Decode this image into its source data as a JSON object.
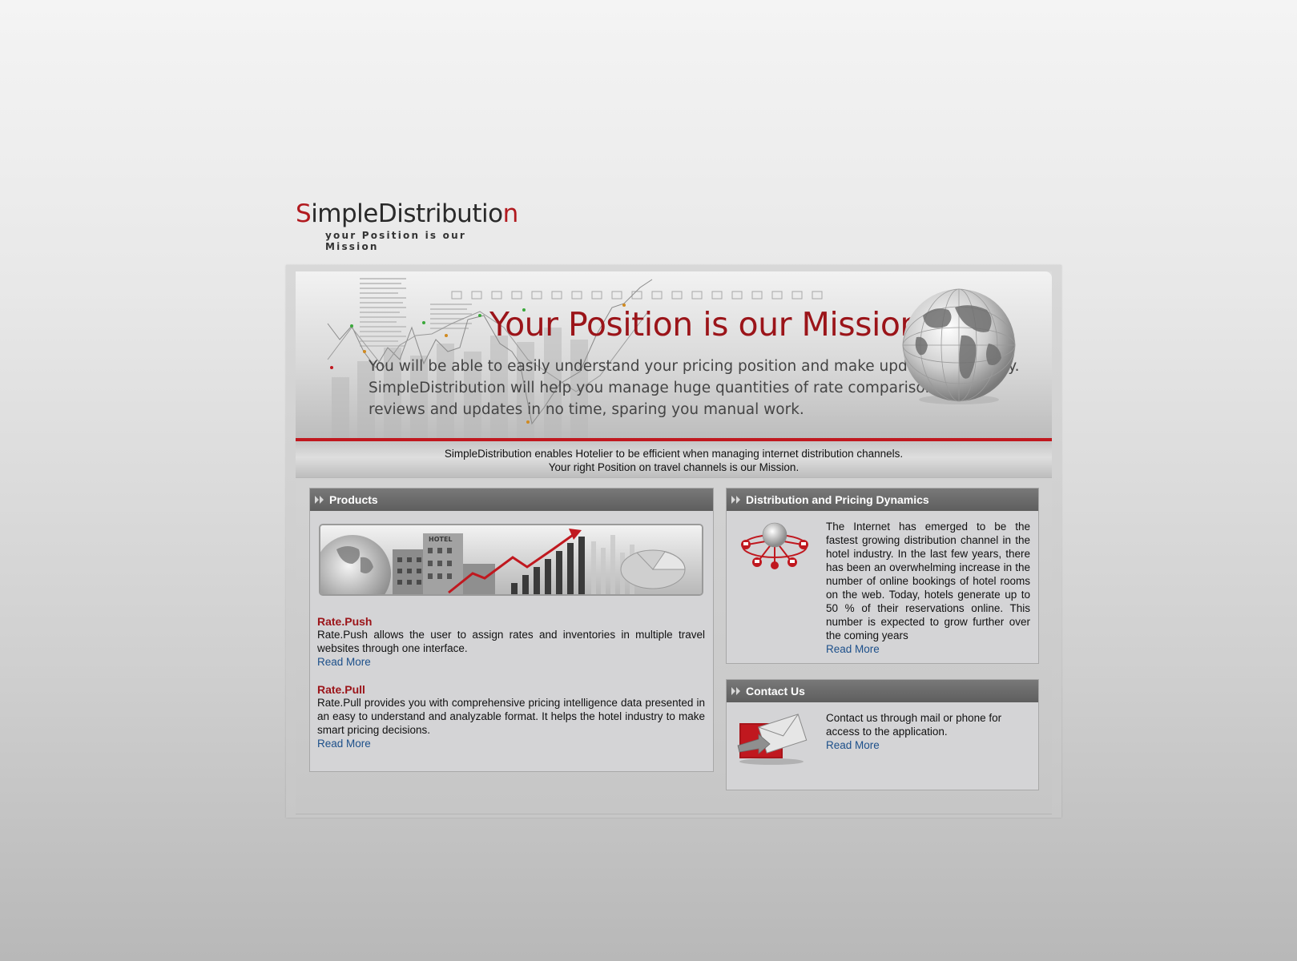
{
  "logo": {
    "title_first": "S",
    "title_middle": "impleDistributio",
    "title_last": "n",
    "tagline": "your Position is our Mission"
  },
  "banner": {
    "headline": "Your Position is our Mission",
    "body_lines": [
      "You will be able to easily understand your pricing position and make updates efficiently.",
      "SimpleDistribution will help you manage huge quantities of rate comparisons,",
      "reviews and updates in no time, sparing you manual work."
    ]
  },
  "tagline": {
    "line1": "SimpleDistribution enables Hotelier to be efficient when managing internet distribution channels.",
    "line2": "Your right Position on travel channels is our Mission."
  },
  "products": {
    "heading": "Products",
    "image_sign": "HOTEL",
    "items": [
      {
        "title": "Rate.Push",
        "text": "Rate.Push allows the user to assign rates and inventories in multiple travel websites through one interface.",
        "link": "Read More"
      },
      {
        "title": "Rate.Pull",
        "text": "Rate.Pull provides you with comprehensive pricing intelligence data presented in an easy to understand and analyzable format. It helps the hotel industry to make smart pricing decisions.",
        "link": "Read More"
      }
    ]
  },
  "distribution": {
    "heading": "Distribution and Pricing Dynamics",
    "text": "The Internet has emerged to be the fastest growing distribution channel in the hotel industry. In the last few years, there has been an overwhelming increase in the number of online bookings of hotel rooms on the web. Today, hotels generate up to 50 % of their reservations online. This number is expected to grow further over the coming years",
    "link": "Read More"
  },
  "contact": {
    "heading": "Contact Us",
    "text": "Contact us through mail or phone for access to the application.",
    "link": "Read More"
  },
  "colors": {
    "brand_red": "#9b1419",
    "link_blue": "#1c4f8a",
    "panel_header": "#686868"
  },
  "icons": [
    "double-chevron-icon",
    "globe-icon",
    "network-globe-icon",
    "mail-envelope-icon",
    "growth-chart-icon"
  ]
}
